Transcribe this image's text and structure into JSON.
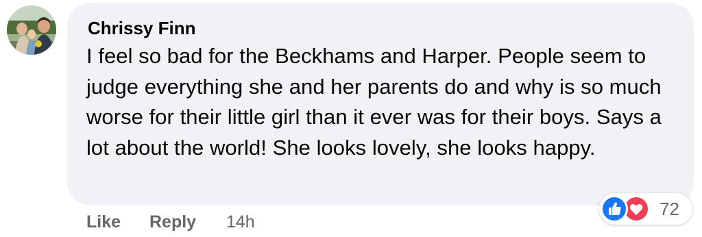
{
  "comment": {
    "author": "Chrissy Finn",
    "text": "I feel so bad for the Beckhams and Harper. People seem to judge everything she and her parents do and why is so much worse for their little girl than it ever was for their boys. Says a lot about the world! She looks lovely, she looks happy.",
    "avatar_icon": "profile-photo",
    "bubble_color": "#f0f2f5"
  },
  "reactions": {
    "icons": [
      "like-icon",
      "love-icon"
    ],
    "like_color": "#1877f2",
    "love_color": "#f33e58",
    "count": "72"
  },
  "actions": {
    "like_label": "Like",
    "reply_label": "Reply",
    "timestamp": "14h"
  }
}
